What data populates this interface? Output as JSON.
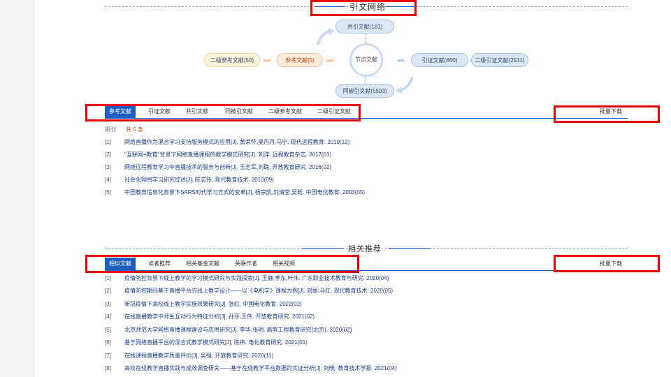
{
  "network": {
    "title": "引文网络",
    "center": "节点文献",
    "nodes": {
      "co_cited": "共引文献(181)",
      "secondary_ref": "二级参考文献(50)",
      "reference": "参考文献(5)",
      "citing": "引证文献(660)",
      "secondary_citing": "二级引证文献(2531)",
      "co_citing": "同被引文献(5503)"
    },
    "arrows": "»»»"
  },
  "ref_tabs": {
    "items": [
      "参考文献",
      "引证文献",
      "共引文献",
      "同被引文献",
      "二级参考文献",
      "二级引证文献"
    ],
    "export": "批量下载"
  },
  "ref_list": {
    "category": "期刊",
    "count": "共 5 条",
    "items": [
      {
        "idx": "[1]",
        "text": "网络直播作为混合学习支持服务模式的应用[J]. 黄荣怀,吴丹丹,马宁. 现代远程教育. 2019(12)"
      },
      {
        "idx": "[2]",
        "text": "\"互联网+教育\"背景下网络直播课程的教学模式研究[J]. 刘洋. 远程教育杂志. 2017(01)"
      },
      {
        "idx": "[3]",
        "text": "网络远程教育学习中直播技术的服务与创新[J]. 王志军,刘璐. 开放教育研究. 2016(02)"
      },
      {
        "idx": "[4]",
        "text": "社会化网络学习研究综述[J]. 陈志伟. 现代教育技术. 2010(09)"
      },
      {
        "idx": "[5]",
        "text": "中国教育信息化背景下SARS时代学习方式的变革[J]. 杨宗凯,刘清堂,吴砥. 中国电化教育. 2003(05)"
      }
    ]
  },
  "related": {
    "title": "相关推荐",
    "tabs": [
      "相似文献",
      "读者推荐",
      "相关基金文献",
      "关联作者",
      "相关视频"
    ],
    "export": "批量下载",
    "items": [
      {
        "idx": "[1]",
        "text": "疫情防控背景下线上教学的学习模式研究与实践探索[J]. 王静,李东,叶伟. 广东职业技术教育与研究. 2020(04)"
      },
      {
        "idx": "[2]",
        "text": "疫情防控期间基于直播平台的线上教学设计——以《电机学》课程为例[J]. 刘丽,马红. 现代教育技术. 2020(05)"
      },
      {
        "idx": "[3]",
        "text": "新冠疫情下高校线上教学实施效果研究[J]. 张红. 中国电化教育. 2022(02)"
      },
      {
        "idx": "[4]",
        "text": "在线直播教学中师生互动行为特征分析[J]. 孙菲,王伟. 开放教育研究. 2021(02)"
      },
      {
        "idx": "[5]",
        "text": "北京师范大学网络直播课程建设与应用研究[J]. 李华,张明. 高等工程教育研究(北京). 2020(02)"
      },
      {
        "idx": "[6]",
        "text": "基于网络直播平台的混合式教学模式研究[J]. 陈伟. 电化教育研究. 2021(01)"
      },
      {
        "idx": "[7]",
        "text": "在线课程直播教学质量评价[J]. 吴强. 开放教育研究. 2020(11)"
      },
      {
        "idx": "[8]",
        "text": "高校在线教学直播实践与成效调查研究——基于在线教学平台数据的实证分析[J]. 刘晓. 教育技术学报. 2021(04)"
      }
    ]
  }
}
